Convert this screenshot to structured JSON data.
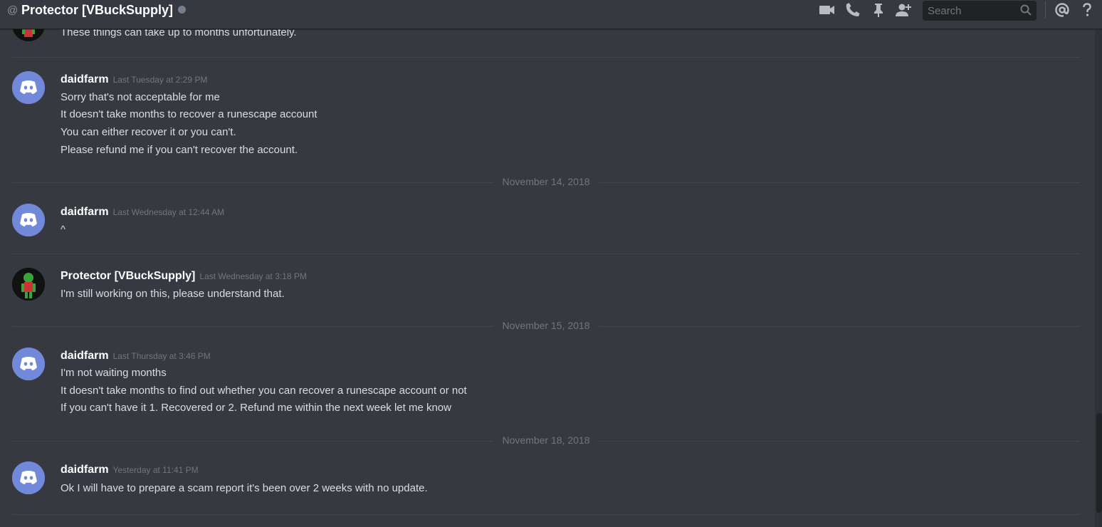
{
  "header": {
    "at": "@",
    "channel_name": "Protector [VBuckSupply]",
    "search_placeholder": "Search"
  },
  "messages": {
    "prev_line": "These things can take up to months unfortunately.",
    "g1": {
      "user": "daidfarm",
      "time": "Last Tuesday at 2:29 PM",
      "lines": [
        "Sorry that's not acceptable for me",
        "It doesn't take months to recover a runescape account",
        "You can either recover it or you can't.",
        "Please refund me if you can't recover the account."
      ]
    },
    "date1": "November 14, 2018",
    "g2": {
      "user": "daidfarm",
      "time": "Last Wednesday at 12:44 AM",
      "lines": [
        "^"
      ]
    },
    "g3": {
      "user": "Protector [VBuckSupply]",
      "time": "Last Wednesday at 3:18 PM",
      "lines": [
        "I'm still working on this, please understand that."
      ]
    },
    "date2": "November 15, 2018",
    "g4": {
      "user": "daidfarm",
      "time": "Last Thursday at 3:46 PM",
      "lines": [
        "I'm not waiting months",
        "It doesn't take months to find out whether you can recover a runescape account or not",
        "If you can't have it 1.  Recovered or 2. Refund me within the next week let me know"
      ]
    },
    "date3": "November 18, 2018",
    "g5": {
      "user": "daidfarm",
      "time": "Yesterday at 11:41 PM",
      "lines": [
        "Ok I will have to prepare a scam report it's been over 2 weeks with no update."
      ]
    }
  },
  "colors": {
    "background": "#36393f",
    "blurple": "#7289da",
    "text": "#dcddde",
    "muted": "#72767d"
  },
  "icons": [
    "video-call-icon",
    "voice-call-icon",
    "pin-icon",
    "add-friend-icon",
    "search-icon",
    "mention-icon",
    "help-icon",
    "discord-logo-icon"
  ]
}
